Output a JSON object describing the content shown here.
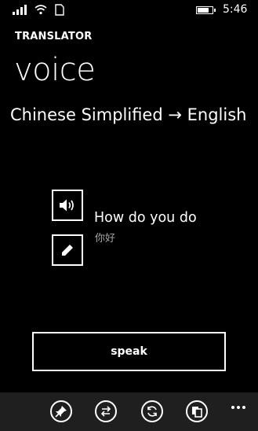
{
  "status_bar": {
    "time": "5:46",
    "icons": [
      "signal-icon",
      "wifi-icon",
      "sim-icon",
      "battery-icon"
    ],
    "battery_level": 0.7
  },
  "header": {
    "app_title": "TRANSLATOR",
    "page_title": "voice",
    "language_pair": "Chinese Simplified → English"
  },
  "result": {
    "translation": "How do you do",
    "source_text": "你好",
    "speaker_icon": "speaker-icon",
    "edit_icon": "pencil-icon"
  },
  "speak_button": {
    "label": "speak"
  },
  "app_bar": {
    "buttons": [
      "pin-icon",
      "swap-icon",
      "refresh-icon",
      "copy-icon"
    ],
    "more_icon": "ellipsis-icon"
  },
  "colors": {
    "background": "#000000",
    "text": "#ffffff",
    "secondary_text": "#a6a6a6",
    "app_bar": "#1f1f1f"
  }
}
